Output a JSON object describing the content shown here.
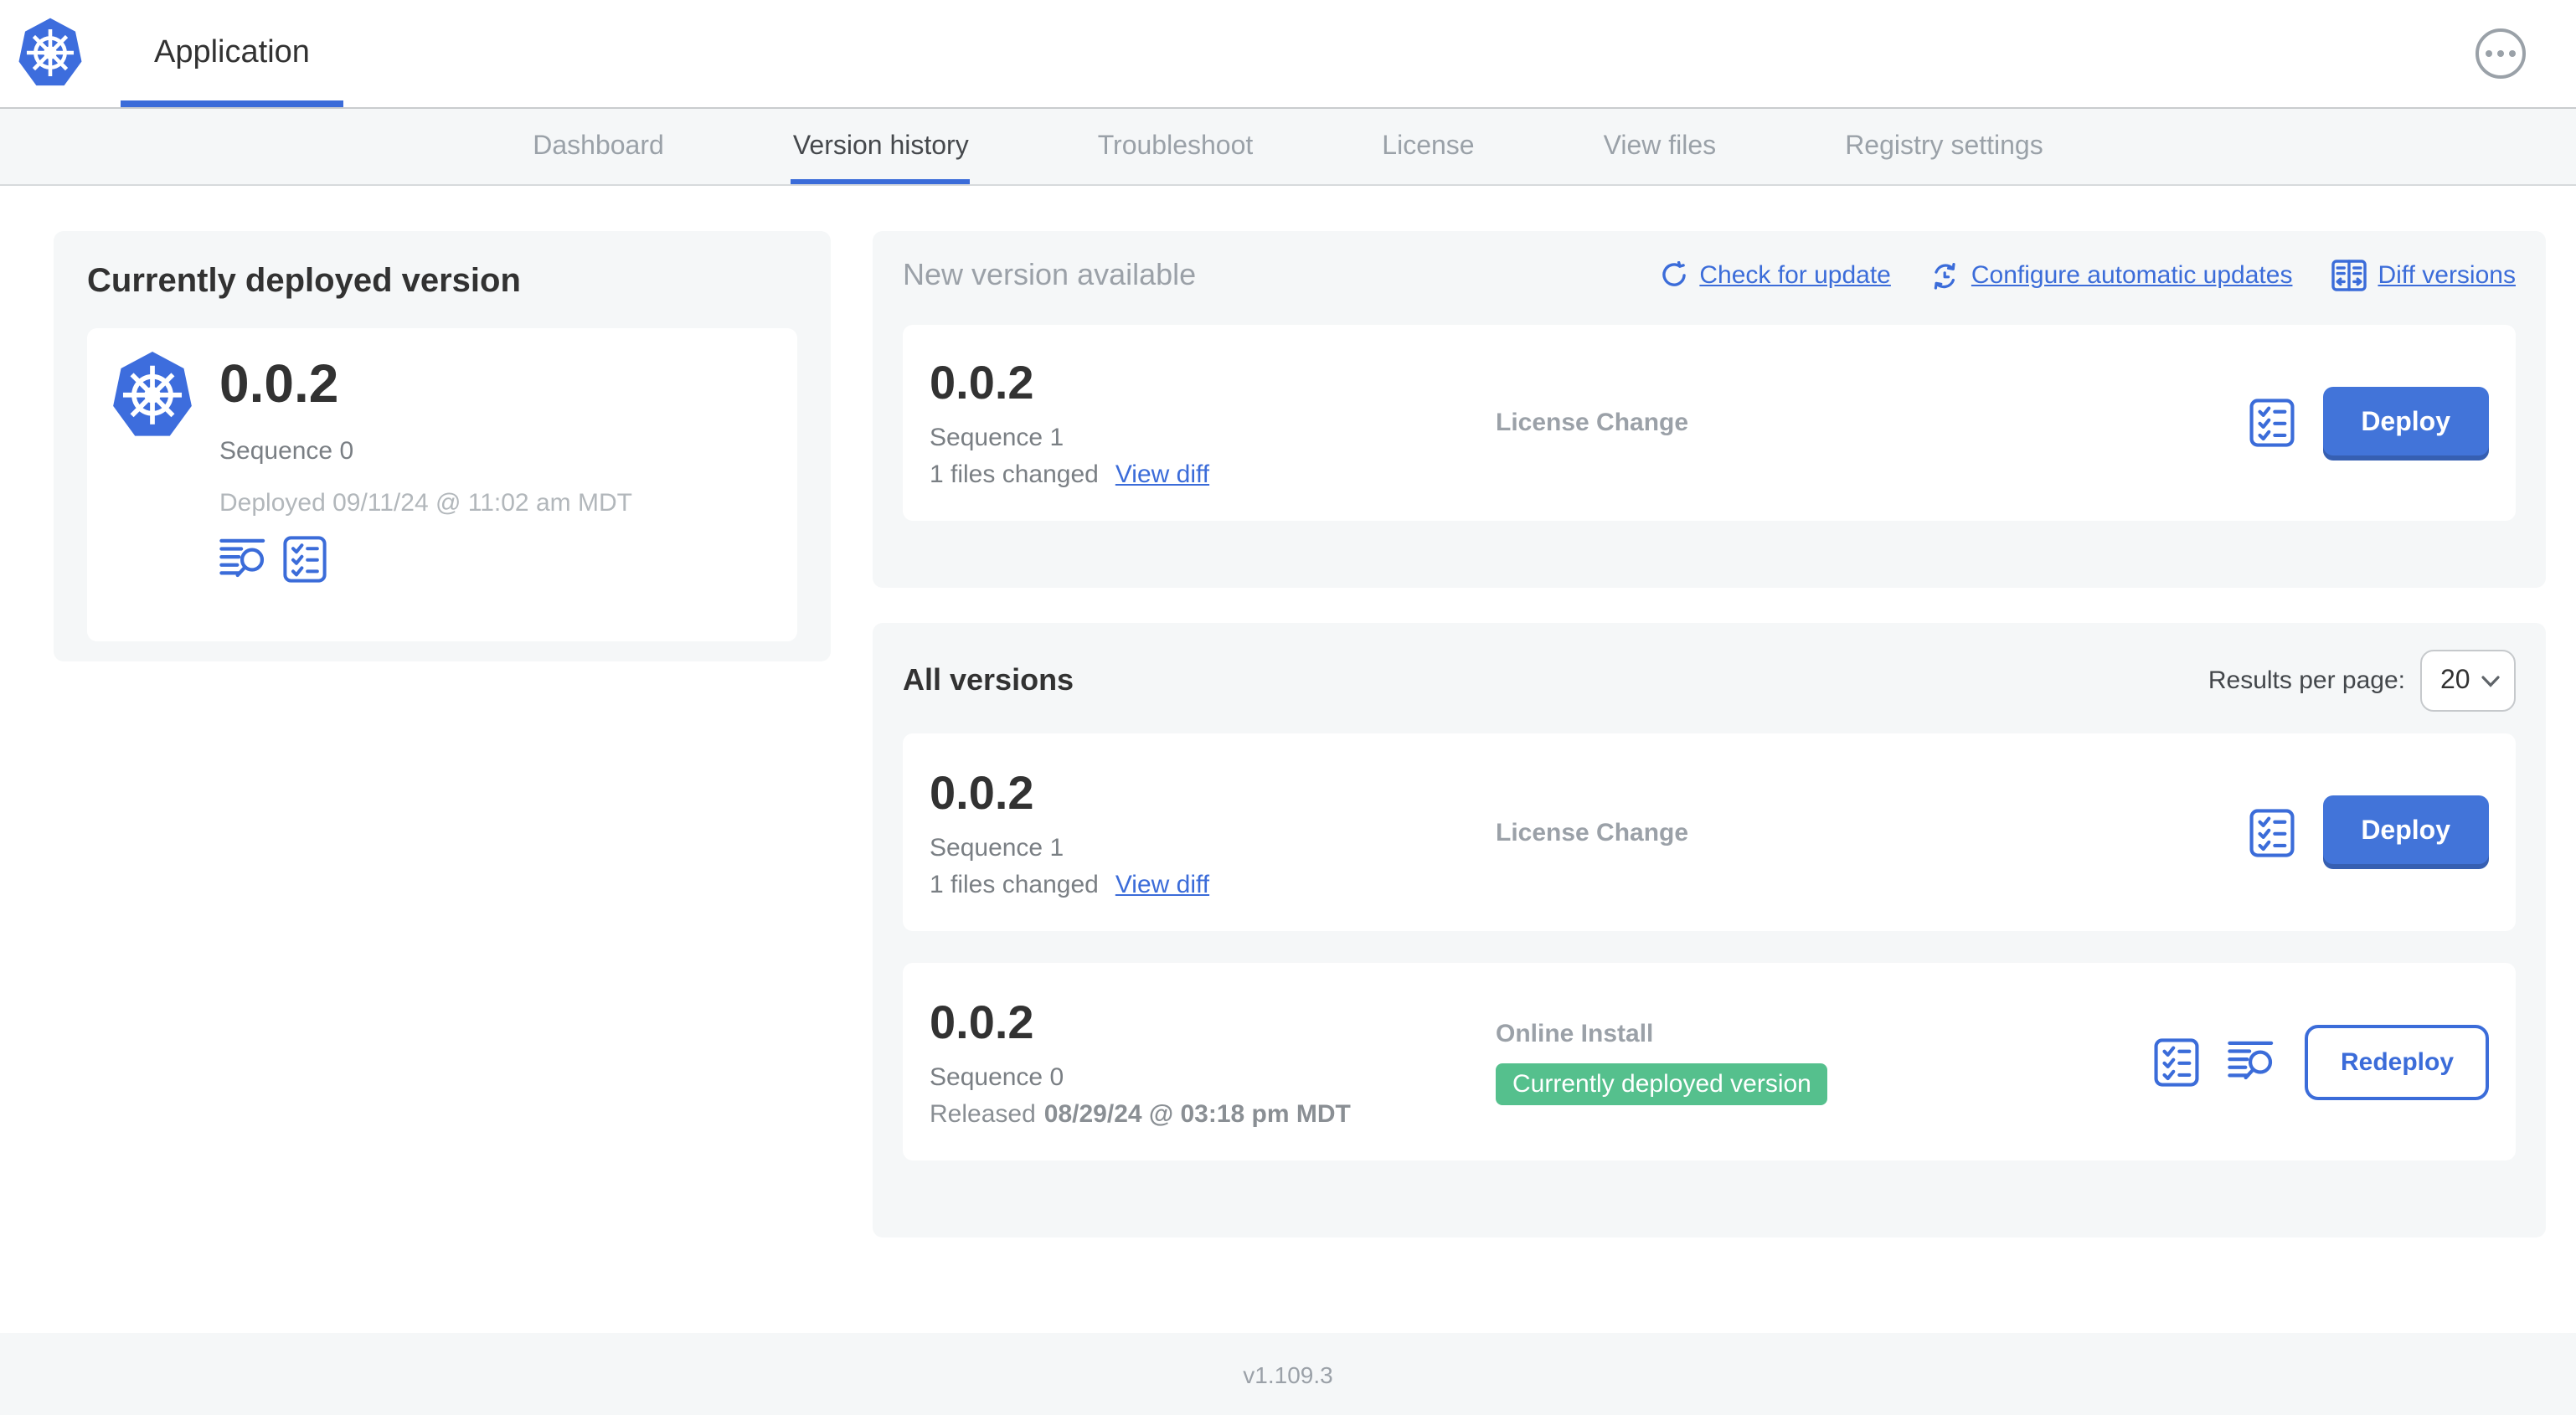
{
  "header": {
    "app_title": "Application"
  },
  "tabs": [
    "Dashboard",
    "Version history",
    "Troubleshoot",
    "License",
    "View files",
    "Registry settings"
  ],
  "current_version": {
    "title": "Currently deployed version",
    "version": "0.0.2",
    "sequence": "Sequence 0",
    "deployed": "Deployed 09/11/24 @ 11:02 am MDT"
  },
  "new_version": {
    "title": "New version available",
    "check_for_update": "Check for update",
    "configure_updates": "Configure automatic updates",
    "diff_versions": "Diff versions",
    "row": {
      "version": "0.0.2",
      "sequence": "Sequence 1",
      "files_changed": "1 files changed",
      "view_diff": "View diff",
      "source": "License Change",
      "action": "Deploy"
    }
  },
  "all_versions": {
    "title": "All versions",
    "results_per_page_label": "Results per page:",
    "results_per_page": "20",
    "rows": [
      {
        "version": "0.0.2",
        "sequence": "Sequence 1",
        "files_changed": "1 files changed",
        "view_diff": "View diff",
        "source": "License Change",
        "action": "Deploy"
      },
      {
        "version": "0.0.2",
        "sequence": "Sequence 0",
        "released_label": "Released",
        "released_value": "08/29/24 @ 03:18 pm MDT",
        "source": "Online Install",
        "badge": "Currently deployed version",
        "action": "Redeploy"
      }
    ]
  },
  "footer": {
    "version": "v1.109.3"
  },
  "icons": {
    "app_logo": "kubernetes-wheel-icon",
    "more": "ellipsis-icon",
    "checklist": "preflight-checklist-icon",
    "logs": "deploy-logs-icon",
    "refresh": "check-update-refresh-icon",
    "auto_update": "sync-clock-icon",
    "diff": "diff-columns-icon",
    "chevron": "chevron-down-icon"
  },
  "colors": {
    "accent": "#3b6cd9",
    "button_blue": "#4274d9",
    "badge_green": "#55c08d",
    "panel_bg": "#f5f7f8",
    "kubernetes_blue": "#3d6ddd",
    "ink": "#323232"
  }
}
